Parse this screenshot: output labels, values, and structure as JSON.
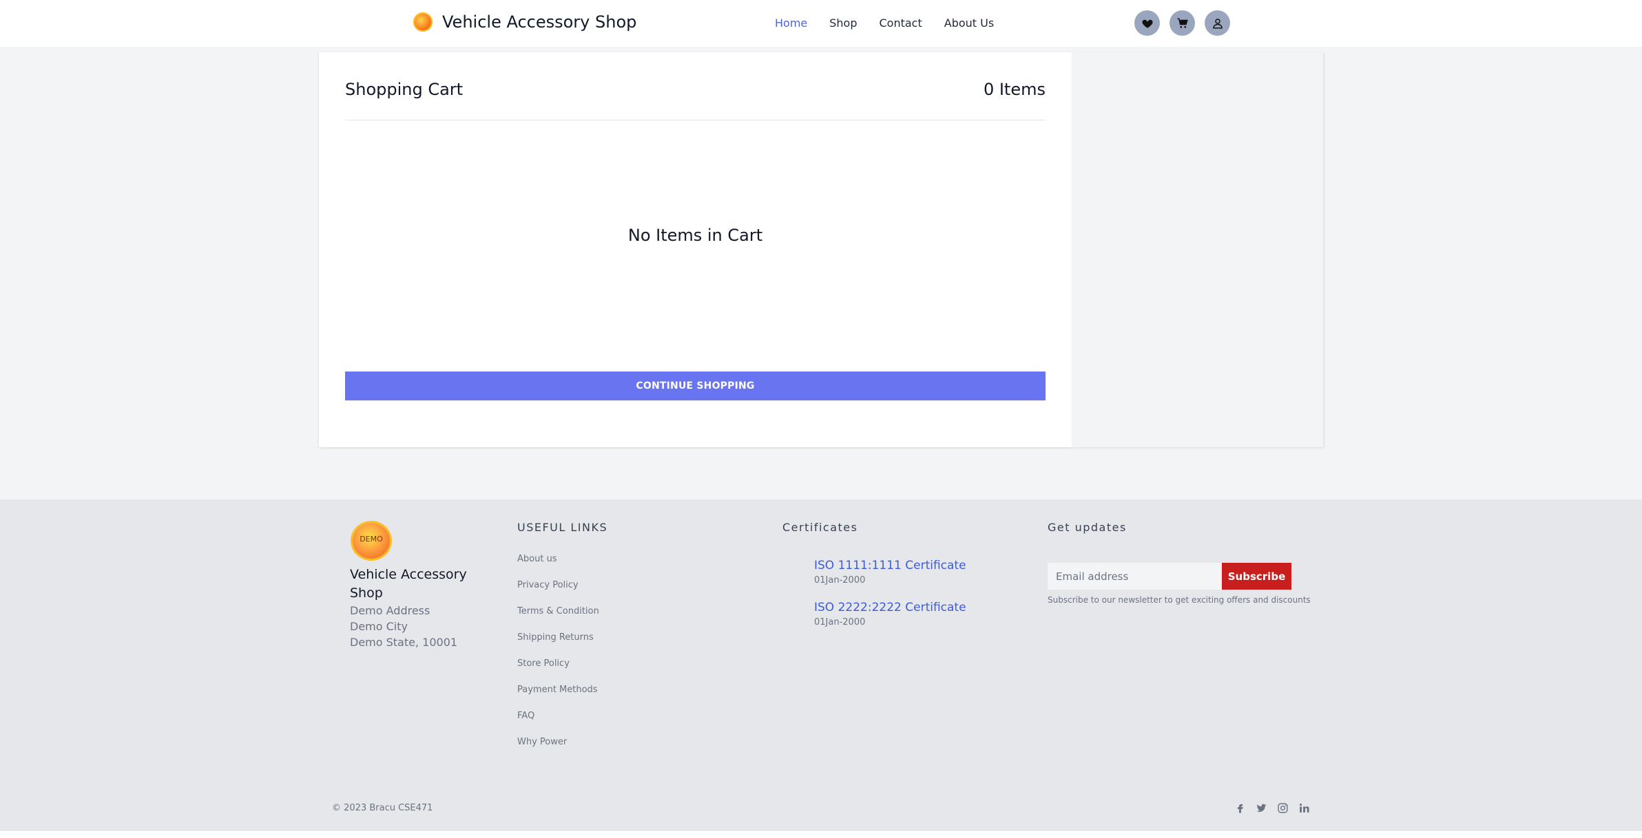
{
  "header": {
    "brand_name": "Vehicle Accessory Shop",
    "nav": [
      {
        "label": "Home",
        "active": true
      },
      {
        "label": "Shop",
        "active": false
      },
      {
        "label": "Contact",
        "active": false
      },
      {
        "label": "About Us",
        "active": false
      }
    ],
    "icons": [
      "heart-icon",
      "cart-icon",
      "user-icon"
    ],
    "accent_color": "#4f63d9"
  },
  "cart": {
    "title": "Shopping Cart",
    "count_label": "0 Items",
    "empty_message": "No Items in Cart",
    "continue_label": "CONTINUE SHOPPING",
    "button_color": "#6874f0"
  },
  "footer": {
    "logo_text": "DEMO",
    "shop_name": "Vehicle Accessory Shop",
    "address": [
      "Demo Address",
      "Demo City",
      "Demo State, 10001"
    ],
    "useful_links_heading": "USEFUL LINKS",
    "useful_links": [
      "About us",
      "Privacy Policy",
      "Terms & Condition",
      "Shipping Returns",
      "Store Policy",
      "Payment Methods",
      "FAQ",
      "Why Power"
    ],
    "certificates_heading": "Certificates",
    "certificates": [
      {
        "name": "ISO 1111:1111 Certificate",
        "date": "01Jan-2000"
      },
      {
        "name": "ISO 2222:2222 Certificate",
        "date": "01Jan-2000"
      }
    ],
    "updates_heading": "Get updates",
    "email_placeholder": "Email address",
    "subscribe_label": "Subscribe",
    "subscribe_note": "Subscribe to our newsletter to get exciting offers and discounts",
    "subscribe_color": "#c81e1e",
    "copyright": "© 2023 Bracu CSE471",
    "social_icons": [
      "facebook-icon",
      "twitter-icon",
      "instagram-icon",
      "linkedin-icon"
    ]
  }
}
